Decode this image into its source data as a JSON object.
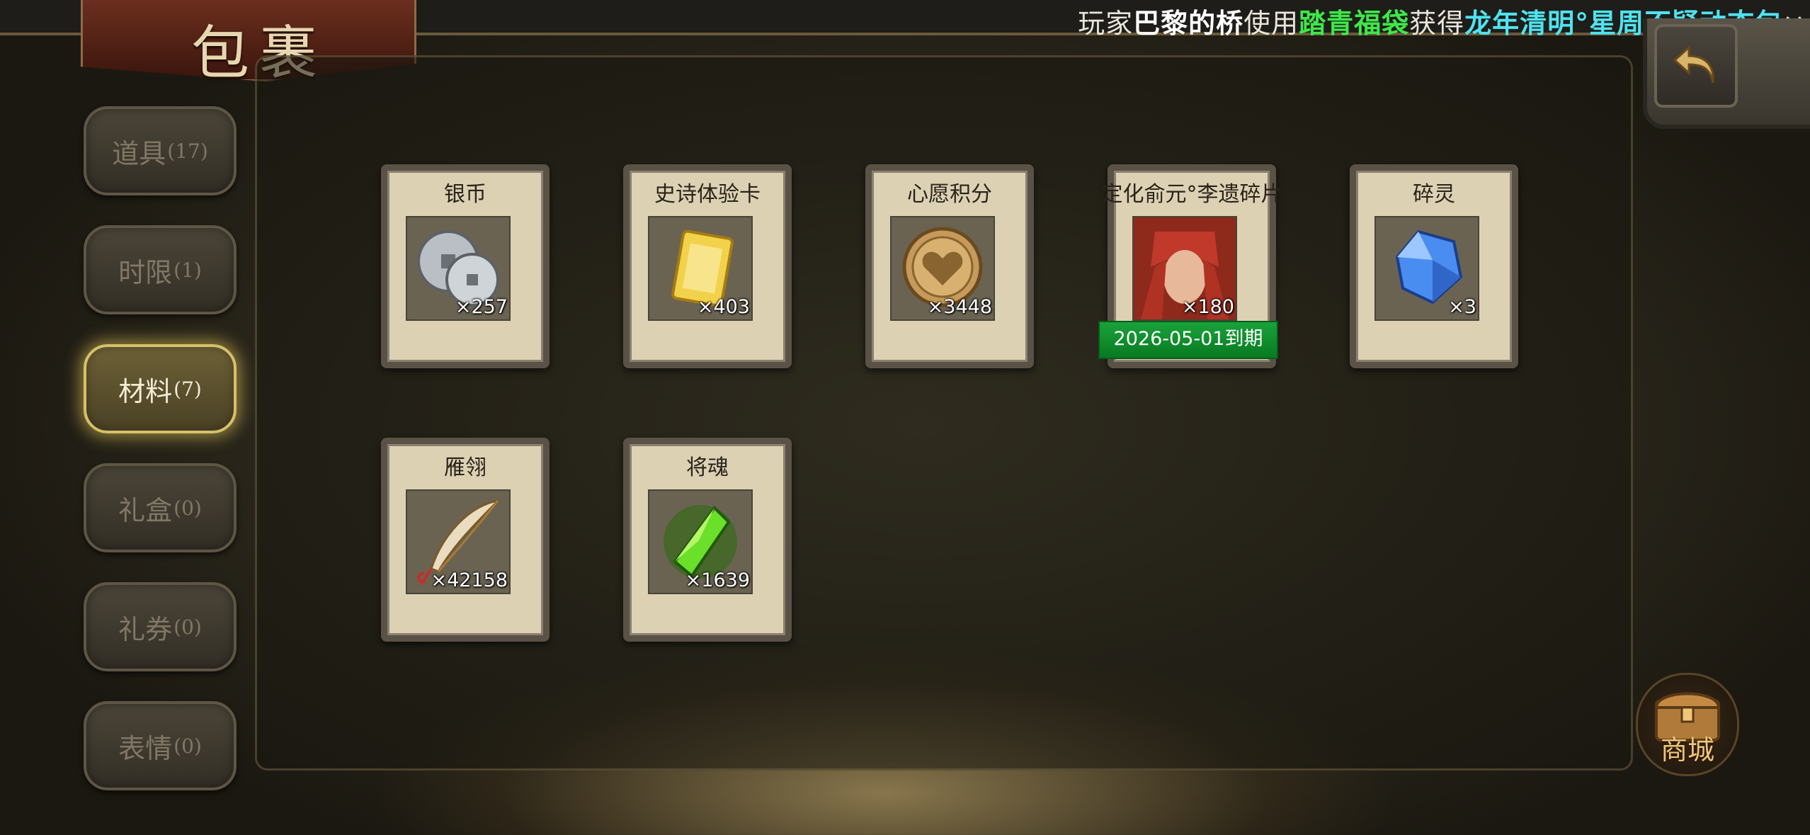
{
  "marquee": {
    "p1": "玩家",
    "player": "巴黎的桥",
    "p2": "使用",
    "item": "踏青福袋",
    "p3": "获得",
    "reward": "龙年清明°星周不疑动态包",
    "close": "×"
  },
  "header": {
    "title": "包裹"
  },
  "tabs": [
    {
      "label": "道具",
      "count": "(17)",
      "active": false
    },
    {
      "label": "时限",
      "count": "(1)",
      "active": false
    },
    {
      "label": "材料",
      "count": "(7)",
      "active": true
    },
    {
      "label": "礼盒",
      "count": "(0)",
      "active": false
    },
    {
      "label": "礼券",
      "count": "(0)",
      "active": false
    },
    {
      "label": "表情",
      "count": "(0)",
      "active": false
    }
  ],
  "items": [
    {
      "name": "银币",
      "count": "×257",
      "icon": "silver-coin-icon"
    },
    {
      "name": "史诗体验卡",
      "count": "×403",
      "icon": "epic-card-icon"
    },
    {
      "name": "心愿积分",
      "count": "×3448",
      "icon": "wish-coin-icon"
    },
    {
      "name": "定化俞元°李遗碎片",
      "count": "×180",
      "icon": "hero-portrait-icon",
      "expiry": "2026-05-01到期"
    },
    {
      "name": "碎灵",
      "count": "×3",
      "icon": "crystal-shard-icon"
    },
    {
      "name": "雁翎",
      "count": "×42158",
      "icon": "feather-icon"
    },
    {
      "name": "将魂",
      "count": "×1639",
      "icon": "green-crystal-icon"
    }
  ],
  "shop": {
    "label": "商城"
  },
  "colors": {
    "marquee_green": "#3ee84a",
    "marquee_cyan": "#4fe3f0",
    "active_tab_glow": "#d6c068",
    "expiry_green": "#1aa23a"
  }
}
